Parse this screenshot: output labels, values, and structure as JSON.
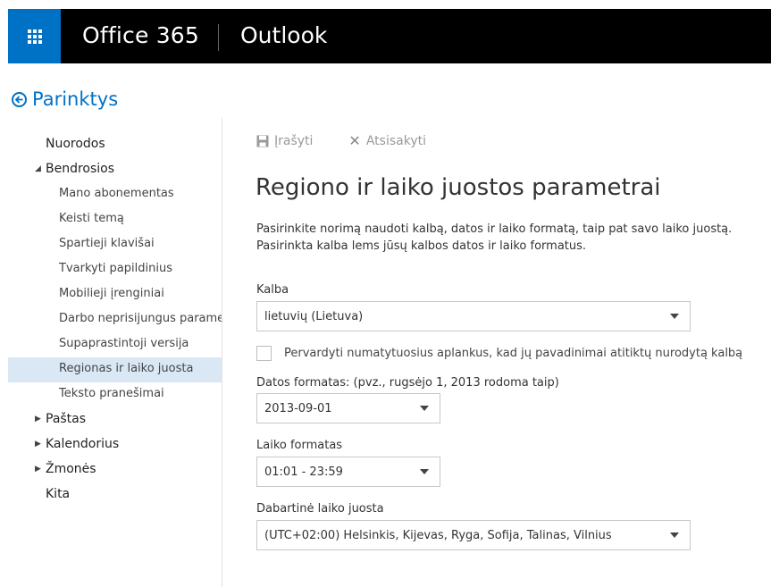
{
  "suite_bar": {
    "brand": "Office 365",
    "app": "Outlook",
    "app_launcher_icon": "waffle-icon"
  },
  "page": {
    "title": "Parinktys",
    "back_icon": "back-arrow-circle-icon"
  },
  "nav": {
    "shortcuts": "Nuorodos",
    "general": "Bendrosios",
    "general_items": [
      "Mano abonementas",
      "Keisti temą",
      "Spartieji klavišai",
      "Tvarkyti papildinius",
      "Mobilieji įrenginiai",
      "Darbo neprisijungus parame",
      "Supaprastintoji versija",
      "Regionas ir laiko juosta",
      "Teksto pranešimai"
    ],
    "mail": "Paštas",
    "calendar": "Kalendorius",
    "people": "Žmonės",
    "other": "Kita",
    "selected": "Regionas ir laiko juosta"
  },
  "toolbar": {
    "save_label": "Įrašyti",
    "cancel_label": "Atsisakyti",
    "save_icon": "floppy-disk-icon",
    "cancel_icon": "x-icon"
  },
  "main": {
    "heading": "Regiono ir laiko juostos parametrai",
    "description_line1": "Pasirinkite norimą naudoti kalbą, datos ir laiko formatą, taip pat savo laiko juostą.",
    "description_line2": "Pasirinkta kalba lems jūsų kalbos datos ir laiko formatus.",
    "language_label": "Kalba",
    "language_value": "lietuvių (Lietuva)",
    "rename_folders_label": "Pervardyti numatytuosius aplankus, kad jų pavadinimai atitiktų nurodytą kalbą",
    "rename_folders_checked": false,
    "date_format_label": "Datos formatas: (pvz., rugsėjo 1, 2013 rodoma taip)",
    "date_format_value": "2013-09-01",
    "time_format_label": "Laiko formatas",
    "time_format_value": "01:01 - 23:59",
    "timezone_label": "Dabartinė laiko juosta",
    "timezone_value": "(UTC+02:00) Helsinkis, Kijevas, Ryga, Sofija, Talinas, Vilnius"
  },
  "colors": {
    "accent": "#0072c6",
    "topbar": "#000000",
    "selected_nav": "#dae8f6"
  }
}
